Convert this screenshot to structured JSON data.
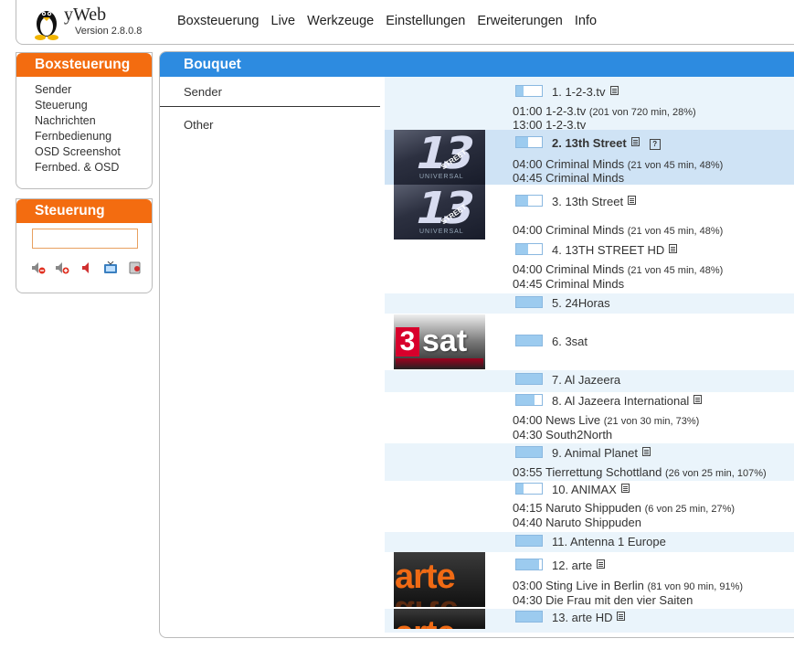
{
  "app": {
    "name": "yWeb",
    "version": "Version 2.8.0.8"
  },
  "topnav": [
    "Boxsteuerung",
    "Live",
    "Werkzeuge",
    "Einstellungen",
    "Erweiterungen",
    "Info"
  ],
  "sidebar": {
    "box1": {
      "title": "Boxsteuerung",
      "items": [
        "Sender",
        "Steuerung",
        "Nachrichten",
        "Fernbedienung",
        "OSD Screenshot",
        "Fernbed. & OSD"
      ]
    },
    "box2": {
      "title": "Steuerung",
      "icons": [
        "volume-down-icon",
        "volume-up-icon",
        "mute-icon",
        "tv-icon",
        "radio-icon"
      ]
    }
  },
  "main": {
    "title": "Bouquet",
    "menu": [
      "Sender",
      "Other"
    ],
    "channels": [
      {
        "label": "1. 1-2-3.tv",
        "progress": 0.28,
        "epg_icon": true,
        "bold": false,
        "logo": "",
        "now_time": "01:00",
        "now_title": "1-2-3.tv",
        "now_info": "(201 von 720 min, 28%)",
        "next_time": "13:00",
        "next_title": "1-2-3.tv"
      },
      {
        "label": "2. 13th Street",
        "progress": 0.48,
        "epg_icon": true,
        "help_icon": true,
        "bold": true,
        "logo": "13th-street",
        "now_time": "04:00",
        "now_title": "Criminal Minds",
        "now_info": "(21 von 45 min, 48%)",
        "next_time": "04:45",
        "next_title": "Criminal Minds"
      },
      {
        "label": "3. 13th Street",
        "progress": 0.48,
        "epg_icon": true,
        "bold": false,
        "logo": "13th-street",
        "now_time": "04:00",
        "now_title": "Criminal Minds",
        "now_info": "(21 von 45 min, 48%)",
        "next_time": "",
        "next_title": ""
      },
      {
        "label": "4. 13TH STREET HD",
        "progress": 0.48,
        "epg_icon": true,
        "bold": false,
        "logo": "",
        "now_time": "04:00",
        "now_title": "Criminal Minds",
        "now_info": "(21 von 45 min, 48%)",
        "next_time": "04:45",
        "next_title": "Criminal Minds"
      },
      {
        "label": "5. 24Horas",
        "progress": 1.0,
        "epg_icon": false,
        "bold": false,
        "logo": ""
      },
      {
        "label": "6. 3sat",
        "progress": 1.0,
        "epg_icon": false,
        "bold": false,
        "logo": "3sat"
      },
      {
        "label": "7. Al Jazeera",
        "progress": 1.0,
        "epg_icon": false,
        "bold": false,
        "logo": ""
      },
      {
        "label": "8. Al Jazeera International",
        "progress": 0.73,
        "epg_icon": true,
        "bold": false,
        "logo": "",
        "now_time": "04:00",
        "now_title": "News Live",
        "now_info": "(21 von 30 min, 73%)",
        "next_time": "04:30",
        "next_title": "South2North"
      },
      {
        "label": "9. Animal Planet",
        "progress": 1.0,
        "epg_icon": true,
        "bold": false,
        "logo": "",
        "now_time": "03:55",
        "now_title": "Tierrettung Schottland",
        "now_info": "(26 von 25 min, 107%)",
        "next_time": "",
        "next_title": ""
      },
      {
        "label": "10. ANIMAX",
        "progress": 0.27,
        "epg_icon": true,
        "bold": false,
        "logo": "",
        "now_time": "04:15",
        "now_title": "Naruto Shippuden",
        "now_info": "(6 von 25 min, 27%)",
        "next_time": "04:40",
        "next_title": "Naruto Shippuden"
      },
      {
        "label": "11. Antenna 1 Europe",
        "progress": 1.0,
        "epg_icon": false,
        "bold": false,
        "logo": ""
      },
      {
        "label": "12. arte",
        "progress": 0.91,
        "epg_icon": true,
        "bold": false,
        "logo": "arte",
        "now_time": "03:00",
        "now_title": "Sting Live in Berlin",
        "now_info": "(81 von 90 min, 91%)",
        "next_time": "04:30",
        "next_title": "Die Frau mit den vier Saiten"
      },
      {
        "label": "13. arte HD",
        "progress": 1.0,
        "epg_icon": true,
        "bold": false,
        "logo": "arte"
      }
    ]
  },
  "logo_text": {
    "l13_num": "13",
    "l13_street": "STREET",
    "l13_universal": "UNIVERSAL",
    "l3sat_3": "3",
    "l3sat_sat": "sat",
    "arte": "arte"
  },
  "colors": {
    "orange": "#f36c10",
    "blue": "#2d8be0",
    "row_alt": "#eaf4fb",
    "row_selected": "#cfe3f5"
  }
}
